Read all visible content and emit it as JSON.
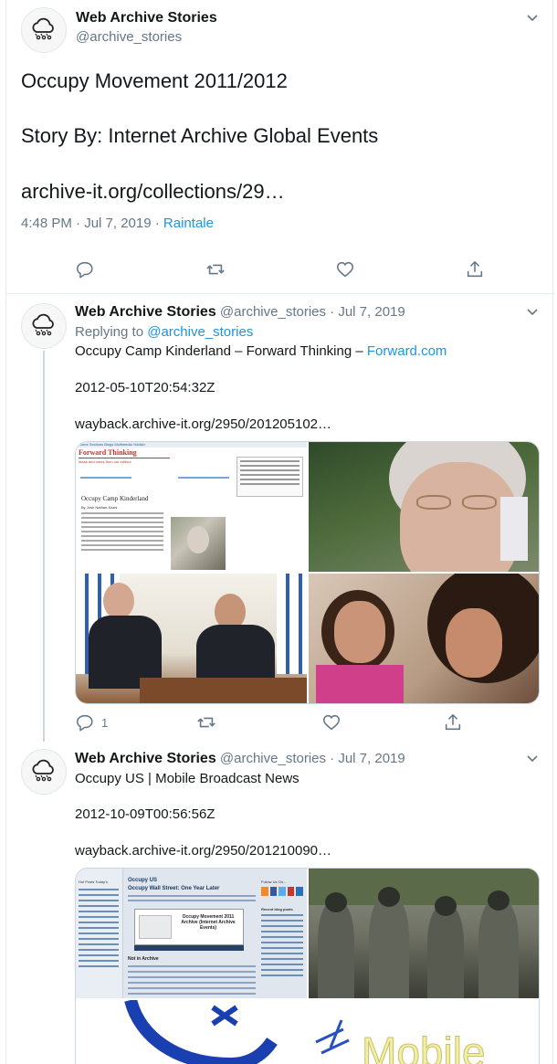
{
  "main": {
    "name": "Web Archive Stories",
    "handle": "@archive_stories",
    "line1": "Occupy Movement 2011/2012",
    "line2": "Story By: Internet Archive Global Events",
    "link": "archive-it.org/collections/29…",
    "time": "4:48 PM · Jul 7, 2019 · ",
    "source": "Raintale"
  },
  "reply1": {
    "name": "Web Archive Stories",
    "handle": "@archive_stories",
    "date": "· Jul 7, 2019",
    "replying_prefix": "Replying to ",
    "replying_handle": "@archive_stories",
    "title": "Occupy Camp Kinderland – Forward Thinking – ",
    "title_link": "Forward.com",
    "timestamp": "2012-05-10T20:54:32Z",
    "link": "wayback.archive-it.org/2950/201205102…",
    "reply_count": "1",
    "thumb": {
      "nav": "Home  Sections  Blogs  Multimedia  Yiddish",
      "logo": "Forward Thinking",
      "subtitle": "Ideas and notes from our editors",
      "headline": "Occupy Camp Kinderland",
      "byline": "By Josh Nathan-Kazis"
    }
  },
  "reply2": {
    "name": "Web Archive Stories",
    "handle": "@archive_stories",
    "date": "· Jul 7, 2019",
    "title": "Occupy US | Mobile Broadcast News",
    "timestamp": "2012-10-09T00:56:56Z",
    "link": "wayback.archive-it.org/2950/201210090…",
    "thumb": {
      "header": "Occupy US",
      "headline": "Occupy Wall Street: One Year Later",
      "box_title": "Occupy Movement 2011 Archive (Internet Archive Events)",
      "not_in_archive": "Not in Archive",
      "follow": "Follow Us On...",
      "recent": "Recent blog posts",
      "hot": "Hot Posts Today's",
      "mobile": "Mobile"
    }
  },
  "colors": {
    "accent": "#1b95e0",
    "muted": "#657786",
    "border": "#e6ecf0"
  },
  "icons": [
    "cloud-rain-avatar-icon",
    "chevron-down-icon",
    "reply-icon",
    "retweet-icon",
    "like-icon",
    "share-icon"
  ]
}
